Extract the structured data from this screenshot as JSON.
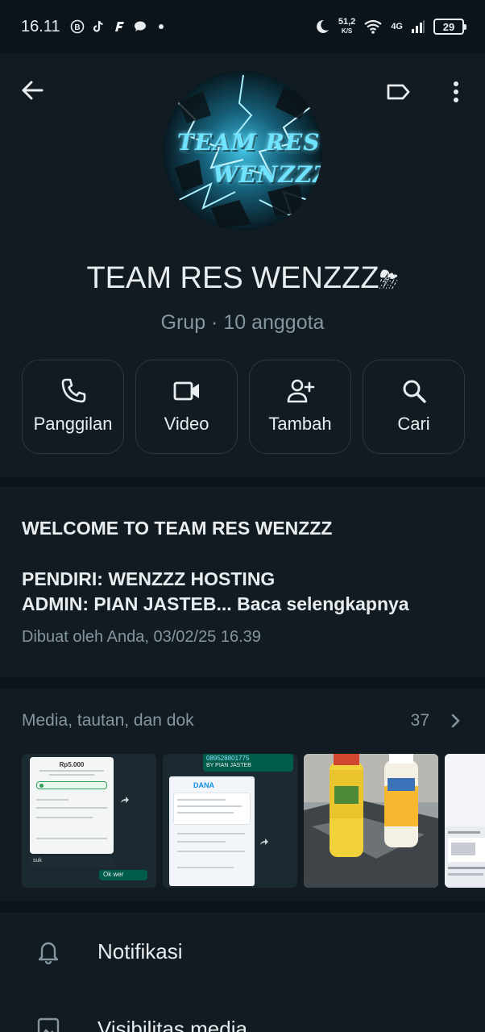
{
  "status_bar": {
    "time": "16.11",
    "speed_value": "51,2",
    "speed_unit": "K/S",
    "network": "4G",
    "battery": "29"
  },
  "header": {
    "group_name": "TEAM RES WENZZZ",
    "group_emoji": "⛈",
    "group_meta": "Grup · 10 anggota",
    "avatar_line1": "TEAM RES",
    "avatar_line2": "WENZZZ"
  },
  "actions": [
    {
      "label": "Panggilan",
      "icon": "phone-icon"
    },
    {
      "label": "Video",
      "icon": "video-icon"
    },
    {
      "label": "Tambah",
      "icon": "add-person-icon"
    },
    {
      "label": "Cari",
      "icon": "search-icon"
    }
  ],
  "description": {
    "line1": "WELCOME TO TEAM RES WENZZZ",
    "line2": "PENDIRI: WENZZZ HOSTING",
    "line3": "ADMIN: PIAN JASTEB...",
    "read_more": "Baca selengkapnya",
    "created": "Dibuat oleh Anda, 03/02/25 16.39"
  },
  "media": {
    "title": "Media, tautan, dan dok",
    "count": "37",
    "thumbs": {
      "t1": {
        "amount": "Rp5.000",
        "bubble1": "suk",
        "bubble2": "Ok wer"
      },
      "t2": {
        "number": "089528801775",
        "by": "BY PIAN JASTEB",
        "brand": "DANA"
      }
    }
  },
  "menu": {
    "notifications": "Notifikasi",
    "media_visibility": "Visibilitas media"
  },
  "colors": {
    "background": "#0b141a",
    "panel": "#111b21",
    "text_primary": "#e9edef",
    "text_secondary": "#8696a0",
    "accent_green": "#005c4b"
  }
}
